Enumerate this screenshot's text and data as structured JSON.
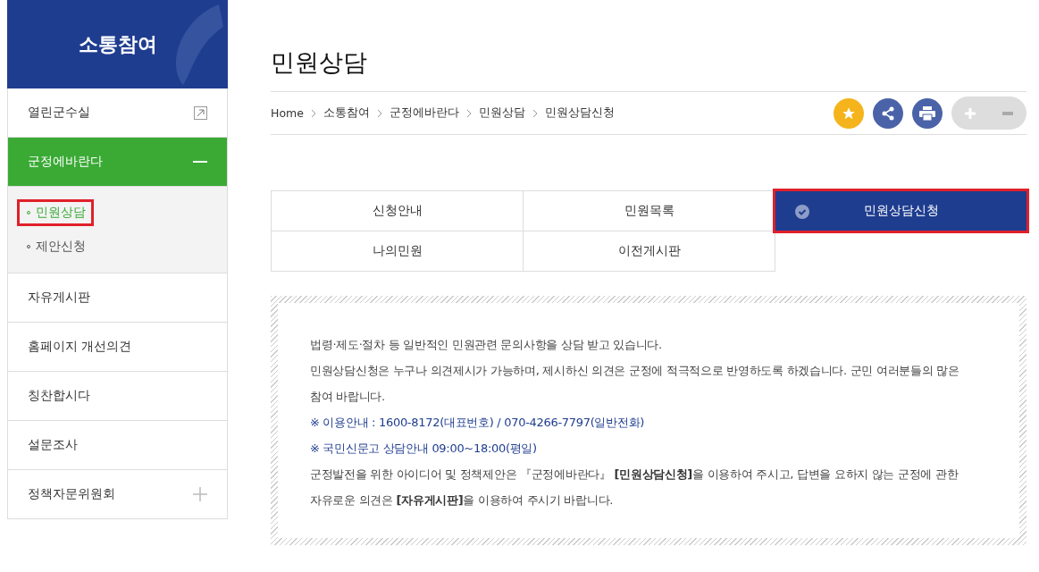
{
  "sidebar": {
    "title": "소통참여",
    "items": [
      {
        "label": "열린군수실",
        "kind": "external",
        "selected": false
      },
      {
        "label": "군정에바란다",
        "kind": "group",
        "selected": true,
        "expanded": true,
        "children": [
          {
            "label": "민원상담",
            "selected": true,
            "highlighted": true
          },
          {
            "label": "제안신청",
            "selected": false,
            "highlighted": false
          }
        ]
      },
      {
        "label": "자유게시판",
        "kind": "plain",
        "selected": false
      },
      {
        "label": "홈페이지 개선의견",
        "kind": "plain",
        "selected": false
      },
      {
        "label": "칭찬합시다",
        "kind": "plain",
        "selected": false
      },
      {
        "label": "설문조사",
        "kind": "plain",
        "selected": false
      },
      {
        "label": "정책자문위원회",
        "kind": "group",
        "selected": false,
        "expanded": false
      }
    ]
  },
  "page": {
    "title": "민원상담",
    "breadcrumb": [
      "Home",
      "소통참여",
      "군정에바란다",
      "민원상담",
      "민원상담신청"
    ]
  },
  "tabs": [
    {
      "label": "신청안내",
      "selected": false,
      "highlighted": false
    },
    {
      "label": "민원목록",
      "selected": false,
      "highlighted": false
    },
    {
      "label": "민원상담신청",
      "selected": true,
      "highlighted": true
    },
    {
      "label": "나의민원",
      "selected": false,
      "highlighted": false
    },
    {
      "label": "이전게시판",
      "selected": false,
      "highlighted": false
    }
  ],
  "notice": [
    {
      "kind": "text",
      "text": "법령·제도·절차 등 일반적인 민원관련 문의사항을 상담 받고 있습니다."
    },
    {
      "kind": "text",
      "text": "민원상담신청은 누구나 의견제시가 가능하며, 제시하신 의견은 군정에 적극적으로 반영하도록 하겠습니다. 군민 여러분들의 많은 참여 바랍니다."
    },
    {
      "kind": "info",
      "text": "※ 이용안내 : 1600-8172(대표번호) / 070-4266-7797(일반전화)"
    },
    {
      "kind": "info",
      "text": "※ 국민신문고 상담안내 09:00~18:00(평일)"
    },
    {
      "kind": "text",
      "text": "군정발전을 위한 아이디어 및 정책제안은 『군정에바란다』 **[민원상담신청]**을 이용하여 주시고, 답변을 요하지 않는 군정에 관한 자유로운 의견은 **[자유게시판]**을 이용하여 주시기 바랍니다."
    }
  ]
}
